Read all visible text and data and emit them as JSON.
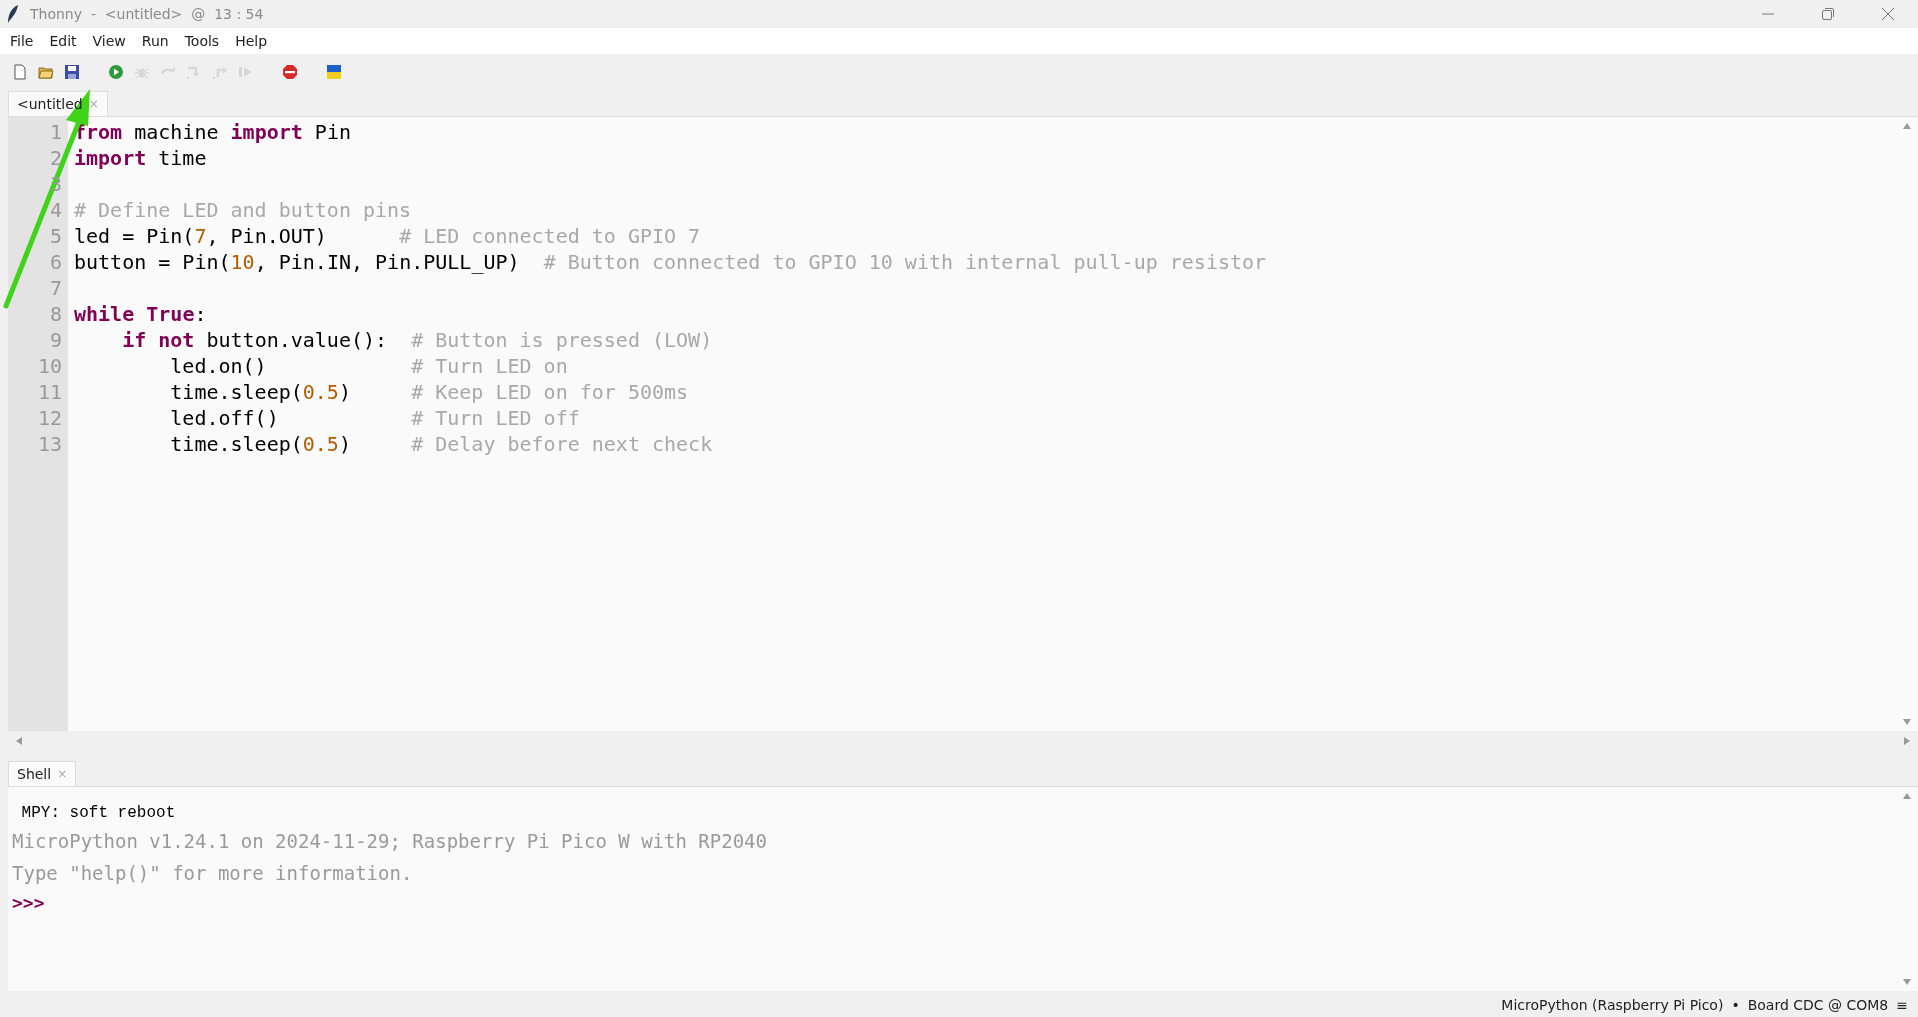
{
  "window": {
    "title": "Thonny  -  <untitled>  @  13 : 54"
  },
  "menu": [
    "File",
    "Edit",
    "View",
    "Run",
    "Tools",
    "Help"
  ],
  "toolbar": [
    {
      "kind": "new",
      "disabled": false
    },
    {
      "kind": "open",
      "disabled": false
    },
    {
      "kind": "save",
      "disabled": false
    },
    {
      "kind": "run",
      "disabled": false
    },
    {
      "kind": "debug",
      "disabled": true
    },
    {
      "kind": "step-over",
      "disabled": true
    },
    {
      "kind": "step-into",
      "disabled": true
    },
    {
      "kind": "step-out",
      "disabled": true
    },
    {
      "kind": "resume",
      "disabled": true
    },
    {
      "kind": "stop",
      "disabled": false
    },
    {
      "kind": "flag",
      "disabled": false
    }
  ],
  "editor_tabs": [
    {
      "label": "<untitled",
      "selected": true,
      "close": "×"
    }
  ],
  "code": [
    {
      "number": "1",
      "tokens": [
        {
          "kind": "keyword",
          "text": "from"
        },
        {
          "kind": "plain",
          "text": " machine "
        },
        {
          "kind": "keyword",
          "text": "import"
        },
        {
          "kind": "plain",
          "text": " Pin"
        }
      ]
    },
    {
      "number": "2",
      "tokens": [
        {
          "kind": "keyword",
          "text": "import"
        },
        {
          "kind": "plain",
          "text": " time"
        }
      ]
    },
    {
      "number": "3"
    },
    {
      "number": "4",
      "tokens": [
        {
          "kind": "comment",
          "text": "# Define LED and button pins"
        }
      ]
    },
    {
      "number": "5",
      "tokens": [
        {
          "kind": "plain",
          "text": "led = Pin("
        },
        {
          "kind": "number",
          "text": "7"
        },
        {
          "kind": "plain",
          "text": ", Pin.OUT)      "
        },
        {
          "kind": "comment",
          "text": "# LED connected to GPIO 7"
        }
      ]
    },
    {
      "number": "6",
      "tokens": [
        {
          "kind": "plain",
          "text": "button = Pin("
        },
        {
          "kind": "number",
          "text": "10"
        },
        {
          "kind": "plain",
          "text": ", Pin.IN, Pin.PULL_UP)  "
        },
        {
          "kind": "comment",
          "text": "# Button connected to GPIO 10 with internal pull-up resistor"
        }
      ]
    },
    {
      "number": "7"
    },
    {
      "number": "8",
      "tokens": [
        {
          "kind": "keyword",
          "text": "while"
        },
        {
          "kind": "keyword",
          "text": " True"
        },
        {
          "kind": "plain",
          "text": ":"
        }
      ]
    },
    {
      "number": "9",
      "tokens": [
        {
          "kind": "keyword",
          "text": "    if"
        },
        {
          "kind": "keyword",
          "text": " not"
        },
        {
          "kind": "plain",
          "text": " button.value():  "
        },
        {
          "kind": "comment",
          "text": "# Button is pressed (LOW)"
        }
      ]
    },
    {
      "number": "10",
      "tokens": [
        {
          "kind": "plain",
          "text": "        led.on()            "
        },
        {
          "kind": "comment",
          "text": "# Turn LED on"
        }
      ]
    },
    {
      "number": "11",
      "tokens": [
        {
          "kind": "plain",
          "text": "        time.sleep("
        },
        {
          "kind": "number",
          "text": "0.5"
        },
        {
          "kind": "plain",
          "text": ")     "
        },
        {
          "kind": "comment",
          "text": "# Keep LED on for 500ms"
        }
      ]
    },
    {
      "number": "12",
      "tokens": [
        {
          "kind": "plain",
          "text": "        led.off()           "
        },
        {
          "kind": "comment",
          "text": "# Turn LED off"
        }
      ]
    },
    {
      "number": "13",
      "tokens": [
        {
          "kind": "plain",
          "text": "        time.sleep("
        },
        {
          "kind": "number",
          "text": "0.5"
        },
        {
          "kind": "plain",
          "text": ")     "
        },
        {
          "kind": "comment",
          "text": "# Delay before next check"
        }
      ]
    }
  ],
  "shell": {
    "tab": {
      "label": "Shell",
      "selected": true,
      "close": "×"
    },
    "lines": [
      {
        "kind": "output",
        "text": " MPY: soft reboot"
      },
      {
        "kind": "banner",
        "text": "MicroPython v1.24.1 on 2024-11-29; Raspberry Pi Pico W with RP2040"
      },
      {
        "kind": "banner",
        "text": "Type \"help()\" for more information."
      },
      {
        "kind": "prompt",
        "text": ">>>"
      }
    ]
  },
  "status_bar": {
    "interpreter": "MicroPython (Raspberry Pi Pico)",
    "separator": "•",
    "port": "Board CDC @ COM8",
    "menu": "≡"
  }
}
